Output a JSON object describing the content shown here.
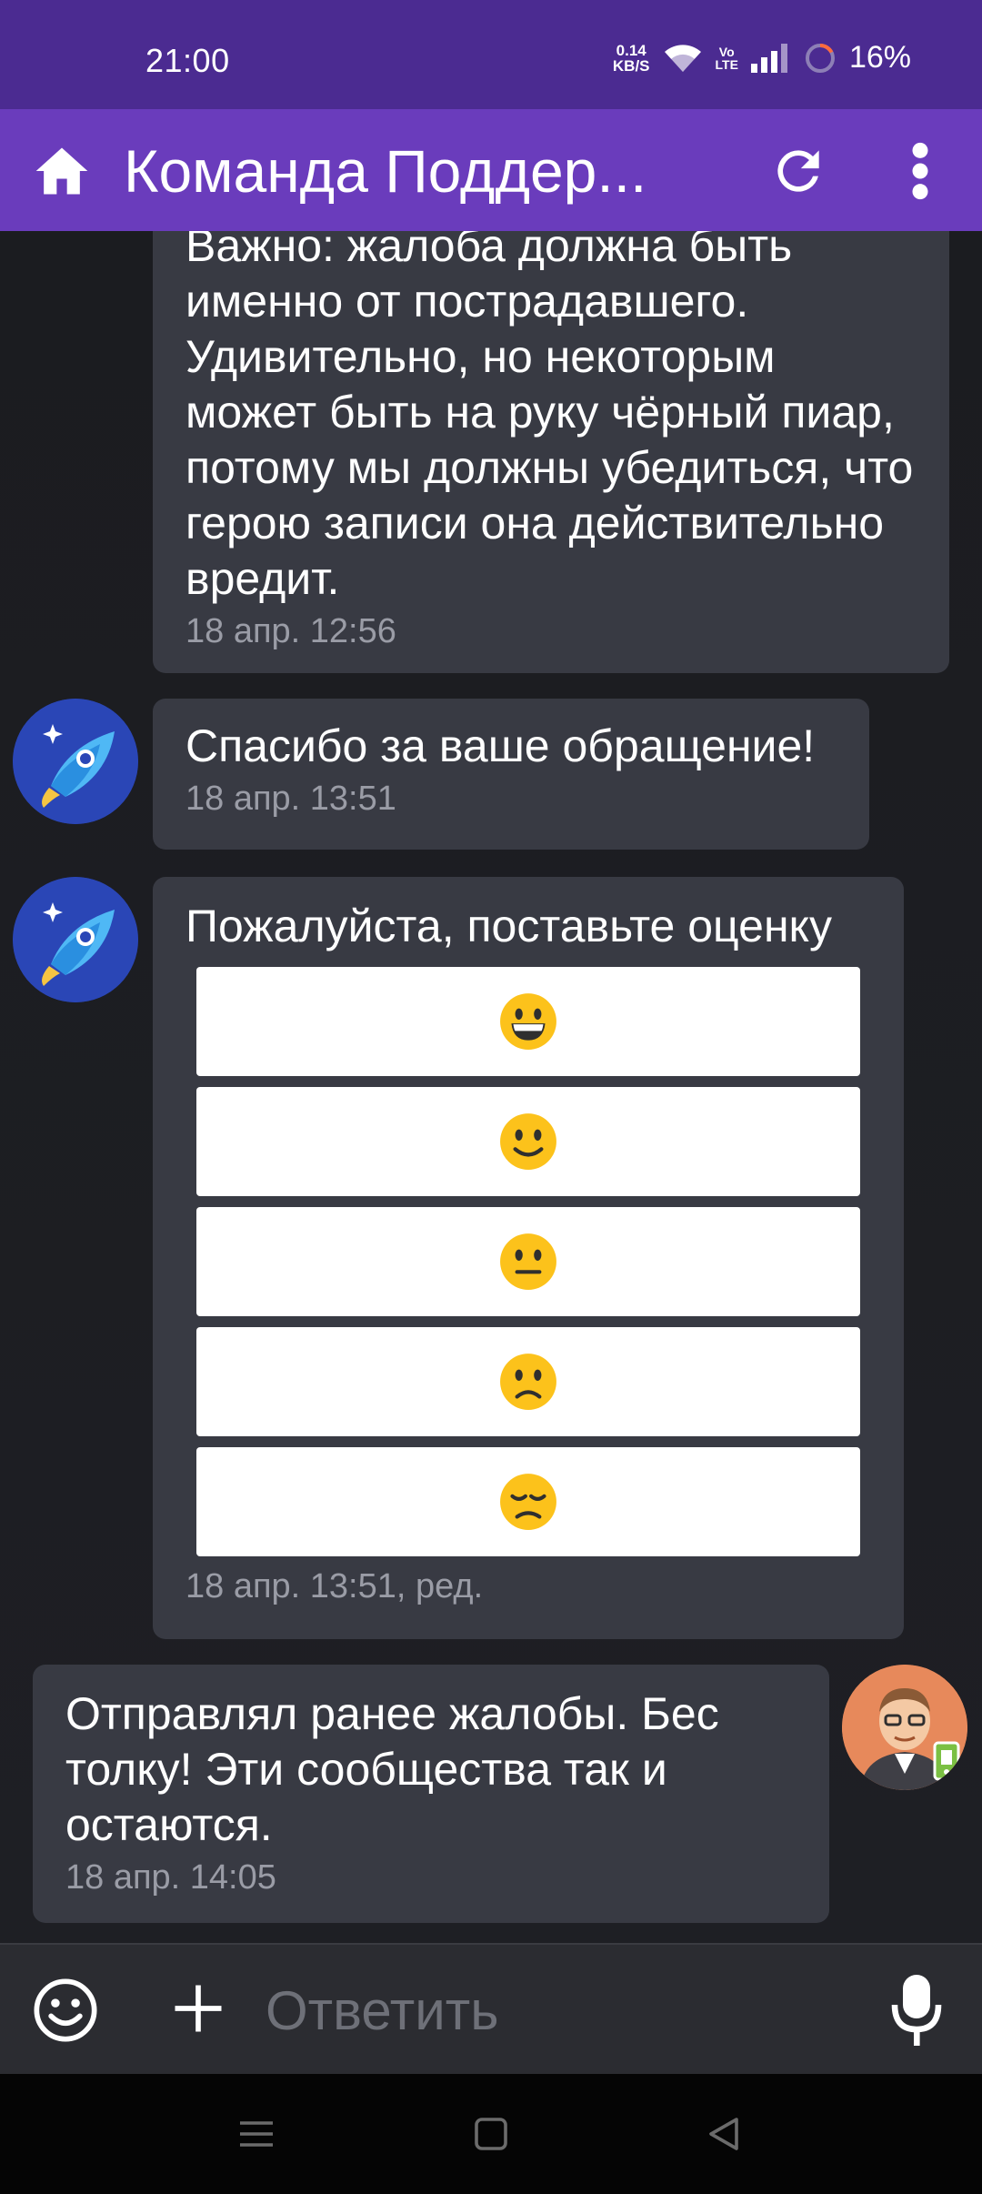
{
  "status_bar": {
    "time": "21:00",
    "net_speed_value": "0.14",
    "net_speed_unit": "KB/S",
    "volte_top": "Vo",
    "volte_bottom": "LTE",
    "battery": "16%"
  },
  "toolbar": {
    "title": "Команда Поддер...",
    "colors": {
      "status_bar": "#4b2b91",
      "toolbar": "#6a3cbc"
    }
  },
  "messages": [
    {
      "id": "m1",
      "text": "Важно: жалоба должна быть именно от пострадавшего. Удивительно, но некоторым может быть на руку чёрный пиар, потому мы должны убедиться, что герою записи она действительно вредит.",
      "timestamp": "18 апр. 12:56"
    },
    {
      "id": "m2",
      "text": "Спасибо за ваше обращение!",
      "timestamp": "18 апр. 13:51"
    },
    {
      "id": "m3",
      "text": "Пожалуйста, поставьте оценку",
      "timestamp": "18 апр. 13:51, ред.",
      "rating_options": [
        "grinning-face",
        "slightly-smiling-face",
        "neutral-face",
        "slightly-frowning-face",
        "disappointed-face"
      ]
    },
    {
      "id": "m4",
      "text": "Отправлял ранее жалобы. Бес толку! Эти сообщества так и остаются.",
      "timestamp": "18 апр. 14:05"
    }
  ],
  "compose": {
    "placeholder": "Ответить"
  }
}
